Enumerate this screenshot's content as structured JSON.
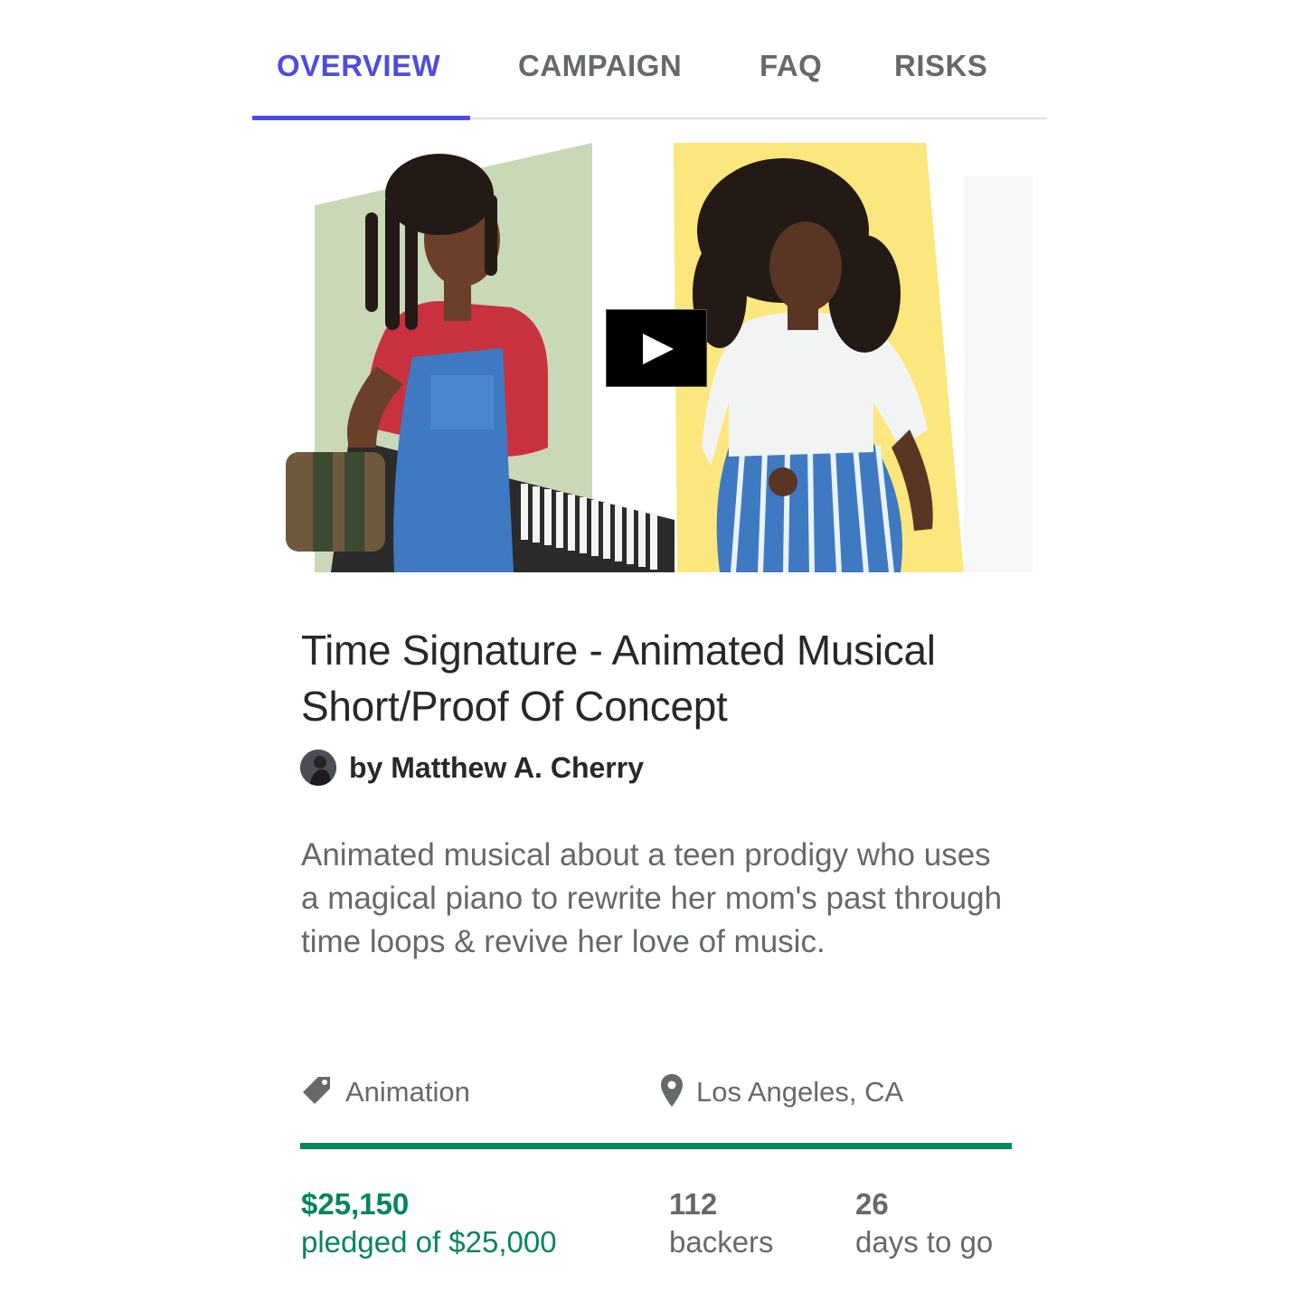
{
  "tabs": [
    {
      "label": "OVERVIEW",
      "active": true
    },
    {
      "label": "CAMPAIGN",
      "active": false
    },
    {
      "label": "FAQ",
      "active": false
    },
    {
      "label": "RISKS",
      "active": false
    }
  ],
  "video": {
    "play_icon": "play-icon",
    "left_panel_color": "#c9d8b6",
    "right_panel_color": "#fbe77d"
  },
  "project": {
    "title": "Time Signature - Animated Musical Short/Proof Of Concept",
    "creator": "by Matthew A. Cherry",
    "blurb": "Animated musical about a teen prodigy who uses a magical piano to rewrite her mom's past through time loops & revive her love of music.",
    "category": "Animation",
    "category_icon": "tag-icon",
    "location": "Los Angeles, CA",
    "location_icon": "location-pin-icon"
  },
  "funding": {
    "pledged": "$25,150",
    "pledged_label": "pledged of $25,000",
    "progress_fraction": 1.0,
    "backers": "112",
    "backers_label": "backers",
    "days": "26",
    "days_label": "days to go"
  },
  "colors": {
    "accent": "#4d4ddf",
    "funded_green": "#05865a",
    "muted_text": "#656969",
    "heading_text": "#282828"
  }
}
